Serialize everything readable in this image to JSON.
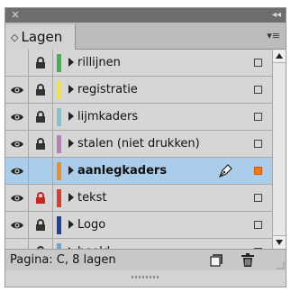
{
  "window": {
    "close_glyph": "×",
    "collapse_glyph": "◂◂"
  },
  "tab": {
    "updown_glyph": "◇",
    "label": "Lagen"
  },
  "panel_menu_glyph": "▾≡",
  "colors": {
    "selection": "#a9cdea",
    "target_active": "#f07a1a"
  },
  "layers": [
    {
      "name": "rillijnen",
      "color": "#3db54a",
      "visible": false,
      "locked": true,
      "lock_color": "#333333",
      "selected": false
    },
    {
      "name": "registratie",
      "color": "#f2e33a",
      "visible": true,
      "locked": true,
      "lock_color": "#333333",
      "selected": false
    },
    {
      "name": "lijmkaders",
      "color": "#7fc6cf",
      "visible": true,
      "locked": true,
      "lock_color": "#333333",
      "selected": false
    },
    {
      "name": "stalen (niet drukken)",
      "color": "#b77fbd",
      "visible": true,
      "locked": true,
      "lock_color": "#333333",
      "selected": false
    },
    {
      "name": "aanlegkaders",
      "color": "#f58b1f",
      "visible": true,
      "locked": false,
      "lock_color": "#333333",
      "selected": true
    },
    {
      "name": "tekst",
      "color": "#e03a2e",
      "visible": true,
      "locked": true,
      "lock_color": "#c8281e",
      "selected": false
    },
    {
      "name": "Logo",
      "color": "#1f3f9a",
      "visible": true,
      "locked": true,
      "lock_color": "#333333",
      "selected": false
    },
    {
      "name": "beeld",
      "color": "#5aa8e0",
      "visible": true,
      "locked": true,
      "lock_color": "#333333",
      "selected": false
    }
  ],
  "footer": {
    "status": "Pagina: C, 8 lagen"
  }
}
